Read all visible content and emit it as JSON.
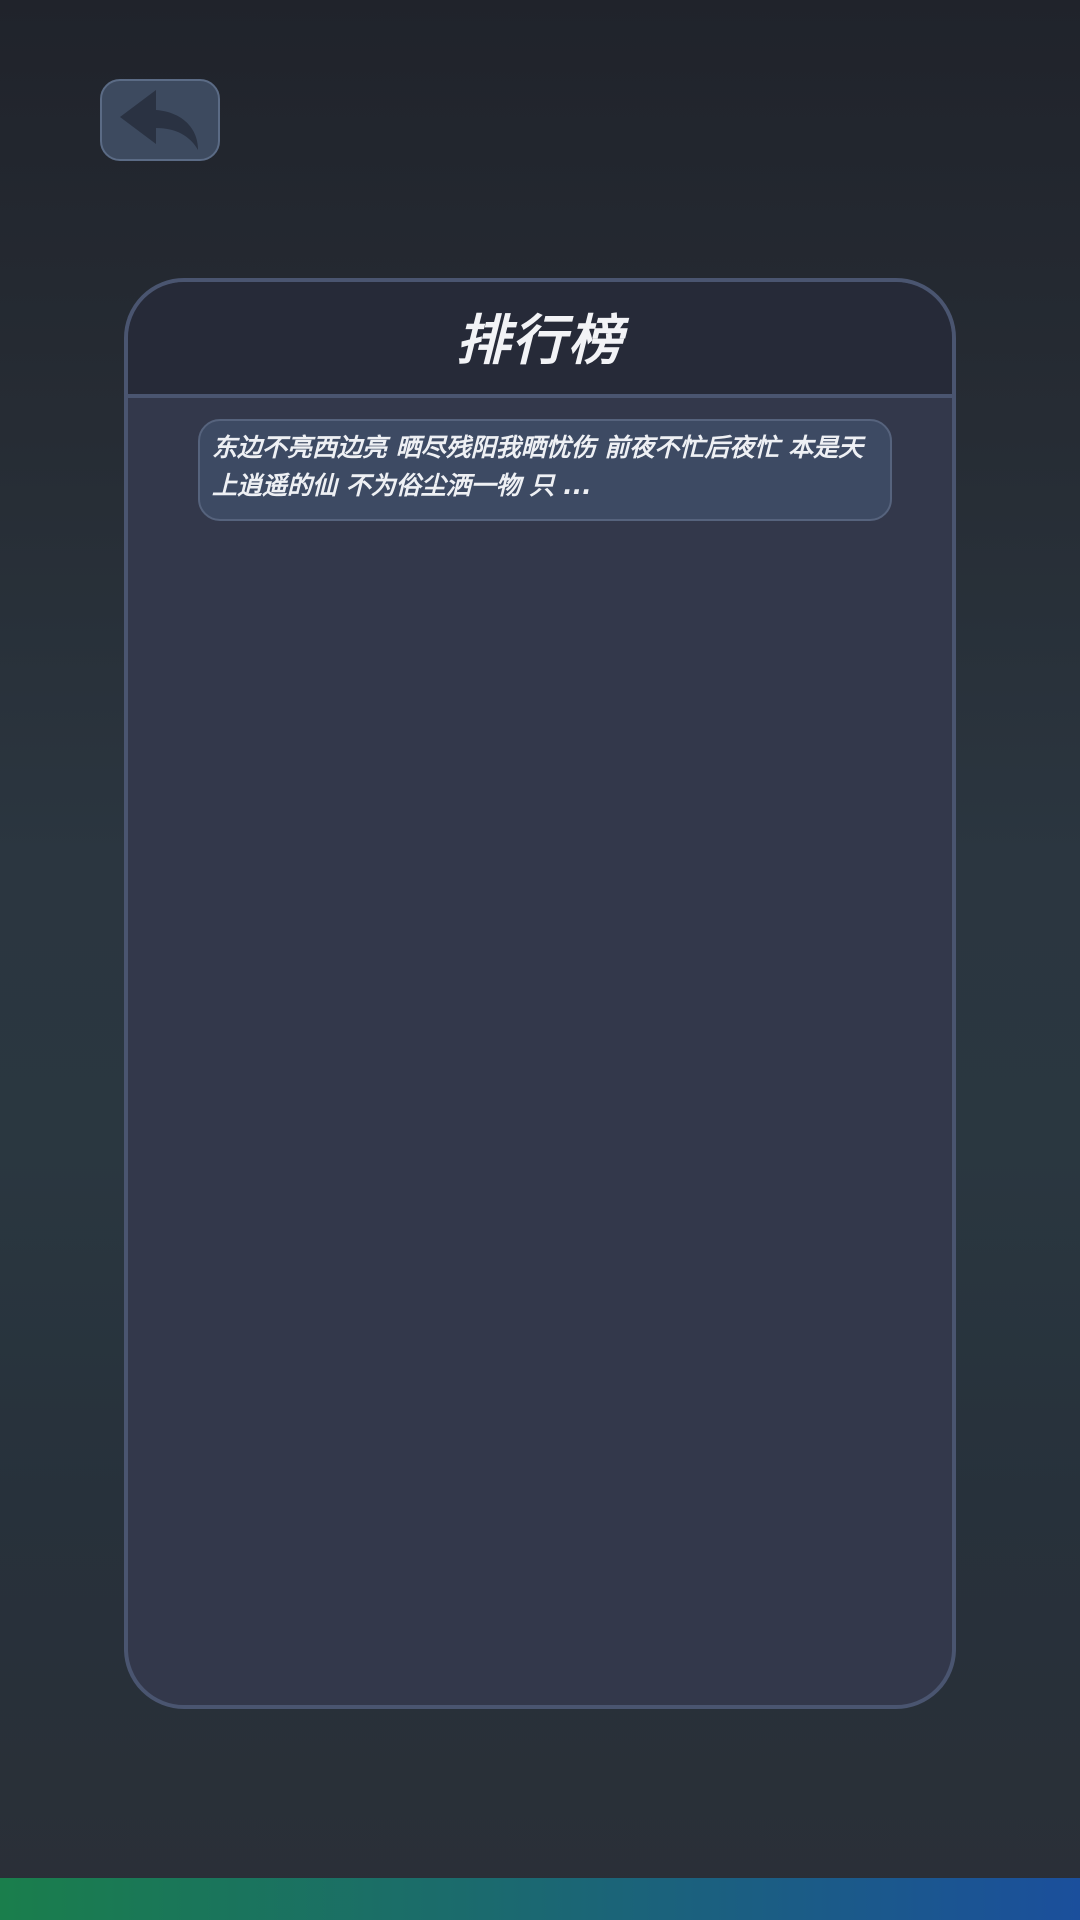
{
  "back_button": {
    "icon": "reply-arrow-icon"
  },
  "leaderboard": {
    "title": "排行榜",
    "entries": [
      {
        "text": "东边不亮西边亮  晒尽残阳我晒忧伤  前夜不忙后夜忙  本是天上逍遥的仙  不为俗尘洒一物  只 ..."
      }
    ]
  },
  "colors": {
    "background_top": "#20232b",
    "panel_border": "#4a5570",
    "panel_fill": "#33384b",
    "header_fill": "#262a38",
    "card_fill": "#3d4a63",
    "bottom_bar_left": "#1a7e4c",
    "bottom_bar_right": "#1b4f9c"
  }
}
